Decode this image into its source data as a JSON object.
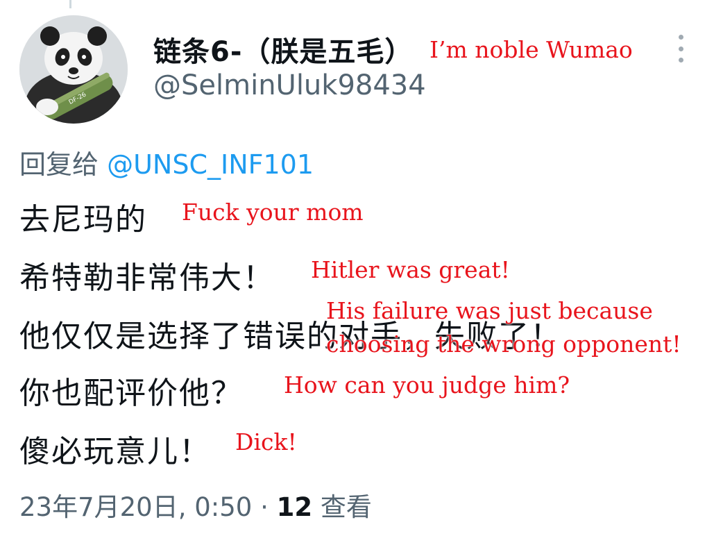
{
  "author": {
    "display_name": "链条6-（朕是五毛）",
    "display_name_annotation": "I’m noble Wumao",
    "handle": "@SelminUluk98434",
    "avatar_icon": "panda-with-missile-avatar"
  },
  "reply": {
    "prefix": "回复给",
    "mention": "@UNSC_INF101"
  },
  "tweet_lines": [
    {
      "text": "去尼玛的",
      "annotation": "Fuck your mom"
    },
    {
      "text": "希特勒非常伟大！",
      "annotation": "Hitler was great!"
    },
    {
      "text": "他仅仅是选择了错误的对手，失败了！",
      "annotation": "His failure was just because",
      "annotation_2": "choosing the wrong opponent!"
    },
    {
      "text": "你也配评价他？",
      "annotation": "How can you judge him?"
    },
    {
      "text": "傻必玩意儿！",
      "annotation": "Dick!"
    }
  ],
  "meta": {
    "timestamp": "23年7月20日, 0:50",
    "separator": "·",
    "views_count": "12",
    "views_label": "查看"
  },
  "colors": {
    "annotation": "#e8141c",
    "mention": "#1d9bf0",
    "secondary_text": "#536471"
  },
  "icons": {
    "more": "more-vertical-icon"
  }
}
